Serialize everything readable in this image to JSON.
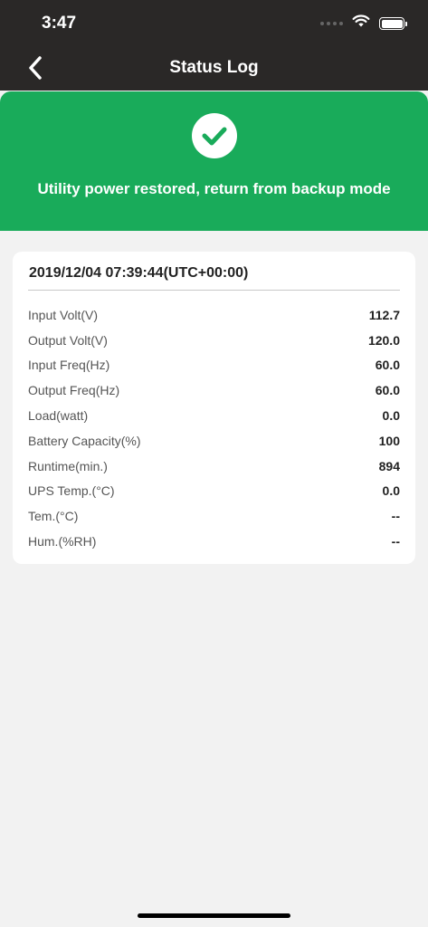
{
  "status_bar": {
    "time": "3:47",
    "icons": [
      "signal-icon",
      "wifi-icon",
      "battery-icon"
    ]
  },
  "nav": {
    "title": "Status Log",
    "back_icon": "chevron-left-icon"
  },
  "banner": {
    "icon": "check-circle-icon",
    "message": "Utility power restored, return from backup mode",
    "color": "#19ab5a"
  },
  "log": {
    "timestamp": "2019/12/04 07:39:44(UTC+00:00)",
    "rows": [
      {
        "label": "Input Volt(V)",
        "value": "112.7"
      },
      {
        "label": "Output Volt(V)",
        "value": "120.0"
      },
      {
        "label": "Input Freq(Hz)",
        "value": "60.0"
      },
      {
        "label": "Output Freq(Hz)",
        "value": "60.0"
      },
      {
        "label": "Load(watt)",
        "value": "0.0"
      },
      {
        "label": "Battery Capacity(%)",
        "value": "100"
      },
      {
        "label": "Runtime(min.)",
        "value": "894"
      },
      {
        "label": "UPS Temp.(°C)",
        "value": "0.0"
      },
      {
        "label": "Tem.(°C)",
        "value": "--"
      },
      {
        "label": "Hum.(%RH)",
        "value": "--"
      }
    ]
  }
}
